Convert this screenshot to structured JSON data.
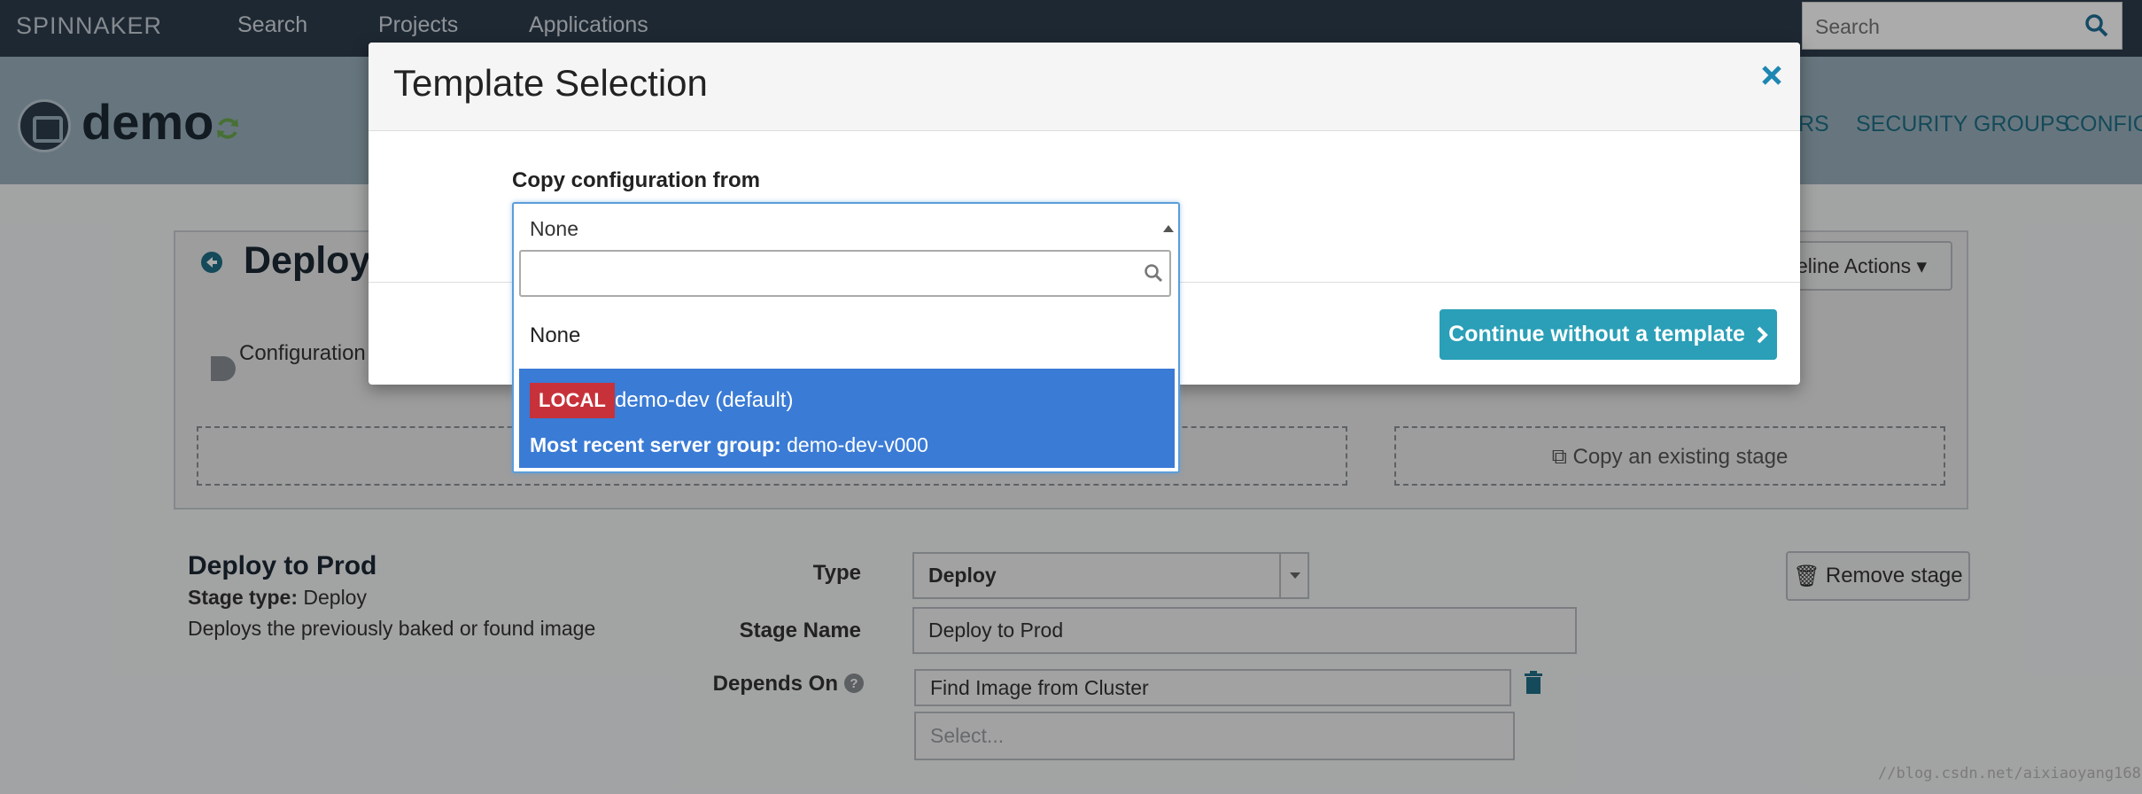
{
  "topnav": {
    "brand": "SPINNAKER",
    "links": [
      "Search",
      "Projects",
      "Applications"
    ],
    "search_placeholder": "Search"
  },
  "app": {
    "name": "demo",
    "nav_partial": "RS",
    "nav": [
      "SECURITY GROUPS",
      "CONFIG"
    ]
  },
  "pipeline": {
    "title_partial": "Deploy t",
    "actions_label": "eline Actions",
    "config_label": "Configuration",
    "copy_stage_label": "Copy an existing stage"
  },
  "stage": {
    "name": "Deploy to Prod",
    "type_label": "Stage type:",
    "type_value": "Deploy",
    "description": "Deploys the previously baked or found image",
    "fields": {
      "type_label": "Type",
      "type_value": "Deploy",
      "name_label": "Stage Name",
      "name_value": "Deploy to Prod",
      "depends_label": "Depends On",
      "depends_value": "Find Image from Cluster",
      "depends_placeholder": "Select..."
    },
    "remove_label": "Remove stage"
  },
  "modal": {
    "title": "Template Selection",
    "copy_label": "Copy configuration from",
    "continue_label": "Continue without a template",
    "dropdown": {
      "selected_value": "None",
      "search_value": "",
      "options": [
        {
          "label": "None"
        },
        {
          "badge": "LOCAL",
          "label": "demo-dev (default)",
          "sub_label": "Most recent server group:",
          "sub_value": "demo-dev-v000",
          "highlighted": true
        }
      ]
    }
  },
  "watermark": "//blog.csdn.net/aixiaoyang168",
  "colors": {
    "topnav_bg": "#2e3d4c",
    "app_header_bg": "#9ab0bd",
    "accent": "#2a9fb7",
    "highlight": "#3a7bd5",
    "badge_local": "#c7323a"
  }
}
